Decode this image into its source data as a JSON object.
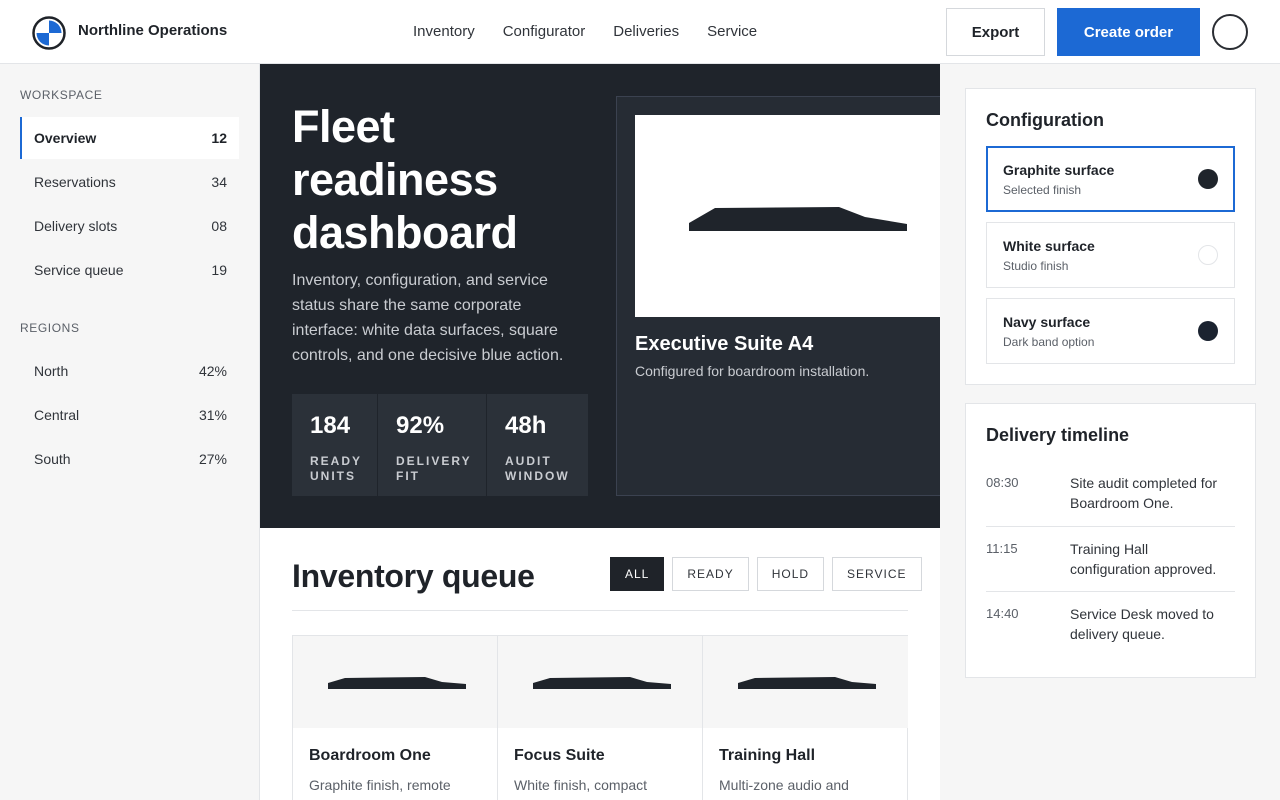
{
  "header": {
    "brand": "Northline Operations",
    "nav": [
      "Inventory",
      "Configurator",
      "Deliveries",
      "Service"
    ],
    "export_label": "Export",
    "create_label": "Create order",
    "accent_color": "#1c69d4"
  },
  "sidebar": {
    "workspace_heading": "WORKSPACE",
    "workspace": [
      {
        "label": "Overview",
        "count": "12"
      },
      {
        "label": "Reservations",
        "count": "34"
      },
      {
        "label": "Delivery slots",
        "count": "08"
      },
      {
        "label": "Service queue",
        "count": "19"
      }
    ],
    "regions_heading": "REGIONS",
    "regions": [
      {
        "label": "North",
        "value": "42%"
      },
      {
        "label": "Central",
        "value": "31%"
      },
      {
        "label": "South",
        "value": "27%"
      }
    ]
  },
  "hero": {
    "title": "Fleet readiness dashboard",
    "description": "Inventory, configuration, and service status share the same corporate interface: white data surfaces, square controls, and one decisive blue action.",
    "stats": [
      {
        "value": "184",
        "label": "READY UNITS"
      },
      {
        "value": "92%",
        "label": "DELIVERY FIT"
      },
      {
        "value": "48h",
        "label": "AUDIT WINDOW"
      }
    ],
    "feature": {
      "title": "Executive Suite A4",
      "subtitle": "Configured for boardroom installation."
    }
  },
  "inventory": {
    "title": "Inventory queue",
    "filters": [
      "ALL",
      "READY",
      "HOLD",
      "SERVICE"
    ],
    "cards": [
      {
        "title": "Boardroom One",
        "desc": "Graphite finish, remote service contract."
      },
      {
        "title": "Focus Suite",
        "desc": "White finish, compact installation."
      },
      {
        "title": "Training Hall",
        "desc": "Multi-zone audio and presentation wall."
      }
    ]
  },
  "configuration": {
    "title": "Configuration",
    "options": [
      {
        "name": "Graphite surface",
        "sub": "Selected finish",
        "color": "#1f242b"
      },
      {
        "name": "White surface",
        "sub": "Studio finish",
        "color": "#ffffff"
      },
      {
        "name": "Navy surface",
        "sub": "Dark band option",
        "color": "#1b2330"
      }
    ]
  },
  "timeline": {
    "title": "Delivery timeline",
    "entries": [
      {
        "time": "08:30",
        "text": "Site audit completed for Boardroom One."
      },
      {
        "time": "11:15",
        "text": "Training Hall configuration approved."
      },
      {
        "time": "14:40",
        "text": "Service Desk moved to delivery queue."
      }
    ]
  }
}
